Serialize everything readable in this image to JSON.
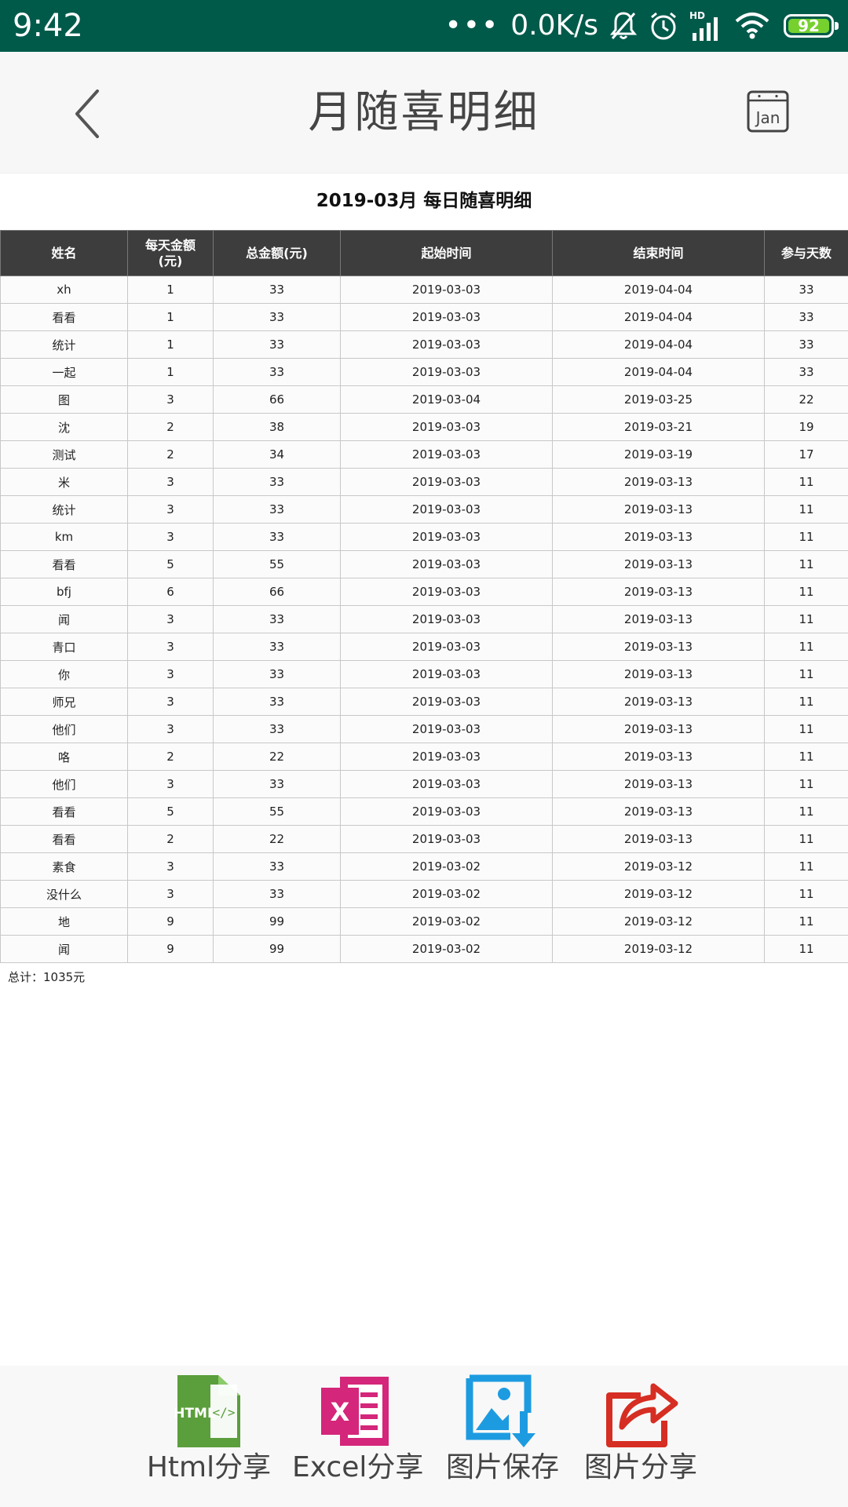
{
  "status_bar": {
    "time": "9:42",
    "dots": "•••",
    "network_speed": "0.0K/s",
    "hd_label": "HD",
    "battery": "92",
    "bg_color": "#005a4a",
    "battery_color": "#76d12f"
  },
  "header": {
    "title": "月随喜明细",
    "calendar_label": "Jan"
  },
  "report": {
    "title": "2019-03月 每日随喜明细",
    "columns": [
      "姓名",
      "每天金额\n(元)",
      "总金额(元)",
      "起始时间",
      "结束时间",
      "参与天数"
    ],
    "rows": [
      [
        "xh",
        "1",
        "33",
        "2019-03-03",
        "2019-04-04",
        "33"
      ],
      [
        "看看",
        "1",
        "33",
        "2019-03-03",
        "2019-04-04",
        "33"
      ],
      [
        "统计",
        "1",
        "33",
        "2019-03-03",
        "2019-04-04",
        "33"
      ],
      [
        "一起",
        "1",
        "33",
        "2019-03-03",
        "2019-04-04",
        "33"
      ],
      [
        "图",
        "3",
        "66",
        "2019-03-04",
        "2019-03-25",
        "22"
      ],
      [
        "沈",
        "2",
        "38",
        "2019-03-03",
        "2019-03-21",
        "19"
      ],
      [
        "测试",
        "2",
        "34",
        "2019-03-03",
        "2019-03-19",
        "17"
      ],
      [
        "米",
        "3",
        "33",
        "2019-03-03",
        "2019-03-13",
        "11"
      ],
      [
        "统计",
        "3",
        "33",
        "2019-03-03",
        "2019-03-13",
        "11"
      ],
      [
        "km",
        "3",
        "33",
        "2019-03-03",
        "2019-03-13",
        "11"
      ],
      [
        "看看",
        "5",
        "55",
        "2019-03-03",
        "2019-03-13",
        "11"
      ],
      [
        "bfj",
        "6",
        "66",
        "2019-03-03",
        "2019-03-13",
        "11"
      ],
      [
        "闻",
        "3",
        "33",
        "2019-03-03",
        "2019-03-13",
        "11"
      ],
      [
        "青口",
        "3",
        "33",
        "2019-03-03",
        "2019-03-13",
        "11"
      ],
      [
        "你",
        "3",
        "33",
        "2019-03-03",
        "2019-03-13",
        "11"
      ],
      [
        "师兄",
        "3",
        "33",
        "2019-03-03",
        "2019-03-13",
        "11"
      ],
      [
        "他们",
        "3",
        "33",
        "2019-03-03",
        "2019-03-13",
        "11"
      ],
      [
        "咯",
        "2",
        "22",
        "2019-03-03",
        "2019-03-13",
        "11"
      ],
      [
        "他们",
        "3",
        "33",
        "2019-03-03",
        "2019-03-13",
        "11"
      ],
      [
        "看看",
        "5",
        "55",
        "2019-03-03",
        "2019-03-13",
        "11"
      ],
      [
        "看看",
        "2",
        "22",
        "2019-03-03",
        "2019-03-13",
        "11"
      ],
      [
        "素食",
        "3",
        "33",
        "2019-03-02",
        "2019-03-12",
        "11"
      ],
      [
        "没什么",
        "3",
        "33",
        "2019-03-02",
        "2019-03-12",
        "11"
      ],
      [
        "地",
        "9",
        "99",
        "2019-03-02",
        "2019-03-12",
        "11"
      ],
      [
        "闻",
        "9",
        "99",
        "2019-03-02",
        "2019-03-12",
        "11"
      ]
    ],
    "total": "总计：1035元"
  },
  "share_bar": {
    "items": [
      {
        "label": "Html分享",
        "icon": "html-file-icon",
        "icon_text": "HTML",
        "color": "#5b9e3c"
      },
      {
        "label": "Excel分享",
        "icon": "excel-file-icon",
        "icon_text": "X",
        "color": "#d4267a"
      },
      {
        "label": "图片保存",
        "icon": "image-save-icon",
        "color": "#1d9be0"
      },
      {
        "label": "图片分享",
        "icon": "share-arrow-icon",
        "color": "#d62e22"
      }
    ]
  }
}
